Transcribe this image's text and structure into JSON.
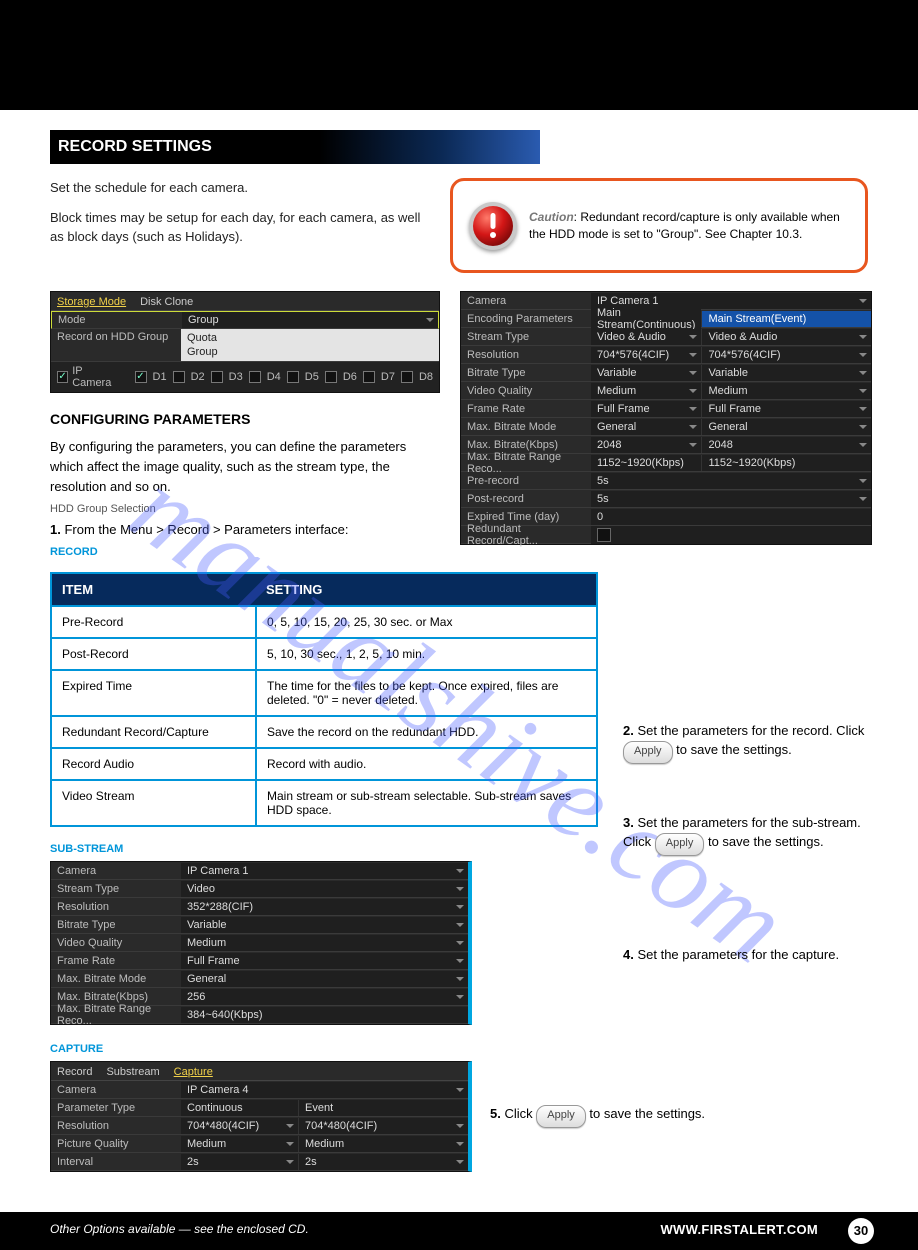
{
  "banner": {
    "title": ""
  },
  "section_title": "RECORD SETTINGS",
  "intro": {
    "p1": "Set the schedule for each camera.",
    "p2": "Block times may be setup for each day, for each camera, as well as block days (such as Holidays)."
  },
  "caution": {
    "label": "Caution",
    "text": "Redundant record/capture is only available when the HDD mode is set to \"Group\". See Chapter 10.3."
  },
  "storage_mode": {
    "tabs": [
      "Storage Mode",
      "Disk Clone"
    ],
    "active_tab": 0,
    "rows": [
      {
        "label": "Mode",
        "value": "Group"
      },
      {
        "label": "Record on HDD Group"
      }
    ],
    "dropdown_options": [
      "Quota",
      "Group"
    ],
    "ip_camera_label": "IP Camera",
    "channels": [
      "D1",
      "D2",
      "D3",
      "D4",
      "D5",
      "D6",
      "D7",
      "D8"
    ]
  },
  "record_panel": {
    "camera_label": "Camera",
    "camera_value": "IP Camera 1",
    "rows": [
      {
        "label": "Encoding Parameters",
        "c1": "Main Stream(Continuous)",
        "c2": "Main Stream(Event)",
        "hl2": true
      },
      {
        "label": "Stream Type",
        "c1": "Video & Audio",
        "c2": "Video & Audio",
        "sel": true
      },
      {
        "label": "Resolution",
        "c1": "704*576(4CIF)",
        "c2": "704*576(4CIF)",
        "sel": true
      },
      {
        "label": "Bitrate Type",
        "c1": "Variable",
        "c2": "Variable",
        "sel": true
      },
      {
        "label": "Video Quality",
        "c1": "Medium",
        "c2": "Medium",
        "sel": true
      },
      {
        "label": "Frame Rate",
        "c1": "Full Frame",
        "c2": "Full Frame",
        "sel": true
      },
      {
        "label": "Max. Bitrate Mode",
        "c1": "General",
        "c2": "General",
        "sel": true
      },
      {
        "label": "Max. Bitrate(Kbps)",
        "c1": "2048",
        "c2": "2048",
        "sel": true
      },
      {
        "label": "Max. Bitrate Range Reco...",
        "c1": "1152~1920(Kbps)",
        "c2": "1152~1920(Kbps)"
      }
    ],
    "single_rows": [
      {
        "label": "Pre-record",
        "value": "5s",
        "sel": true
      },
      {
        "label": "Post-record",
        "value": "5s",
        "sel": true
      },
      {
        "label": "Expired Time (day)",
        "value": "0"
      },
      {
        "label": "Redundant Record/Capt...",
        "checkbox": true
      }
    ]
  },
  "config_para_title": "CONFIGURING PARAMETERS",
  "config_para": "By configuring the parameters, you can define the parameters which affect the image quality, such as the stream type, the resolution and so on.",
  "config_caption": "HDD Group Selection",
  "step1": "From the Menu > Record > Parameters interface:",
  "sub_record": "RECORD",
  "table": {
    "headers": [
      "ITEM",
      "SETTING"
    ],
    "rows": [
      [
        "Pre-Record",
        "0, 5, 10, 15, 20, 25, 30 sec. or Max"
      ],
      [
        "Post-Record",
        "5, 10, 30 sec., 1, 2, 5, 10 min."
      ],
      [
        "Expired Time",
        "The time for the files to be kept. Once expired, files are deleted. \"0\" = never deleted."
      ],
      [
        "Redundant Record/Capture",
        "Save the record on the redundant HDD."
      ],
      [
        "Record Audio",
        "Record with audio."
      ],
      [
        "Video Stream",
        "Main stream or sub-stream selectable. Sub-stream saves HDD space."
      ]
    ]
  },
  "right_steps": {
    "s2_num": "2.",
    "s2_text": "Set the parameters for the record. Click",
    "s2_btn": "Apply",
    "s2_tail": "to save the settings.",
    "s3_num": "3.",
    "s3_text": "Set the parameters for the sub-stream. Click",
    "s3_btn": "Apply",
    "s3_tail": "to save the settings.",
    "s4_num": "4.",
    "s4_text": "Set the parameters for the capture."
  },
  "sub_substream": "SUB-STREAM",
  "substream_panel": {
    "rows": [
      {
        "label": "Camera",
        "value": "IP Camera 1",
        "sel": true
      },
      {
        "label": "Stream Type",
        "value": "Video",
        "sel": true
      },
      {
        "label": "Resolution",
        "value": "352*288(CIF)",
        "sel": true
      },
      {
        "label": "Bitrate Type",
        "value": "Variable",
        "sel": true
      },
      {
        "label": "Video Quality",
        "value": "Medium",
        "sel": true
      },
      {
        "label": "Frame Rate",
        "value": "Full Frame",
        "sel": true
      },
      {
        "label": "Max. Bitrate Mode",
        "value": "General",
        "sel": true
      },
      {
        "label": "Max. Bitrate(Kbps)",
        "value": "256",
        "sel": true
      },
      {
        "label": "Max. Bitrate Range Reco...",
        "value": "384~640(Kbps)"
      }
    ]
  },
  "sub_capture": "CAPTURE",
  "capture_panel": {
    "tabs": [
      "Record",
      "Substream",
      "Capture"
    ],
    "active_tab": 2,
    "rows2": [
      {
        "label": "Camera",
        "c1": "IP Camera 4",
        "sel": true,
        "span": true
      },
      {
        "label": "Parameter Type",
        "c1": "Continuous",
        "c2": "Event"
      },
      {
        "label": "Resolution",
        "c1": "704*480(4CIF)",
        "c2": "704*480(4CIF)",
        "sel": true
      },
      {
        "label": "Picture Quality",
        "c1": "Medium",
        "c2": "Medium",
        "sel": true
      },
      {
        "label": "Interval",
        "c1": "2s",
        "c2": "2s",
        "sel": true
      }
    ]
  },
  "capture_step": {
    "num": "5.",
    "text": "Click",
    "btn": "Apply",
    "tail": "to save the settings."
  },
  "footer": {
    "other": "Other Options available — see the enclosed CD.",
    "site": "WWW.FIRSTALERT.COM",
    "page": "30"
  },
  "watermark": "manualshive.com"
}
